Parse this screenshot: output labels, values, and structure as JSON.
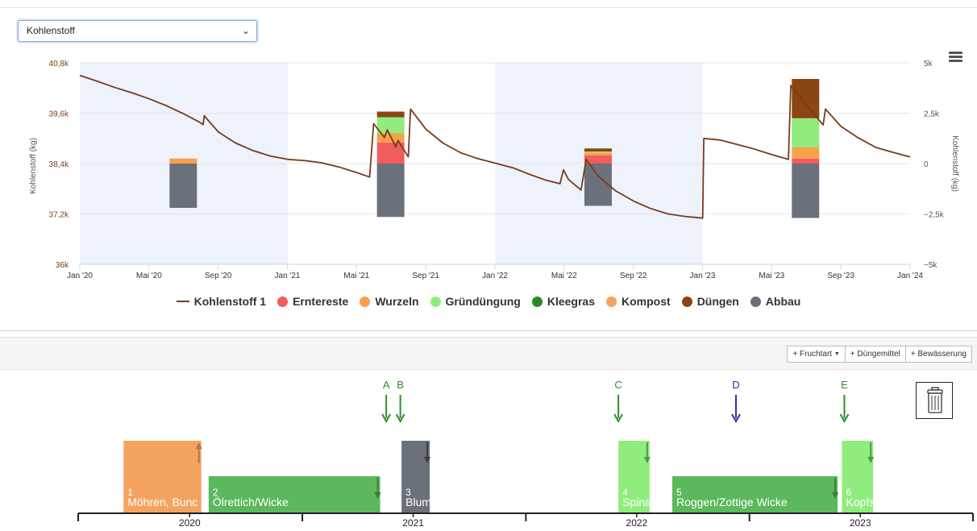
{
  "select": {
    "value": "Kohlenstoff"
  },
  "chart_data": {
    "type": "line+stacked-bar",
    "title": "",
    "yaxis_left": {
      "label": "Kohlenstoff (kg)",
      "range": [
        36000,
        40800
      ],
      "ticks": [
        "40,8k",
        "39,6k",
        "38,4k",
        "37,2k",
        "36k"
      ]
    },
    "yaxis_right": {
      "label": "Kohlenstoff (kg)",
      "range": [
        -5000,
        5000
      ],
      "ticks": [
        "5k",
        "2,5k",
        "0",
        "−2,5k",
        "−5k"
      ]
    },
    "xaxis": {
      "range": [
        "2020-01-01",
        "2024-01-01"
      ],
      "ticks": [
        "Jan '20",
        "Mai '20",
        "Sep '20",
        "Jan '21",
        "Mai '21",
        "Sep '21",
        "Jan '22",
        "Mai '22",
        "Sep '22",
        "Jan '23",
        "Mai '23",
        "Sep '23",
        "Jan '24"
      ]
    },
    "shaded_years": [
      "2020",
      "2022"
    ],
    "legend_position": "bottom",
    "line": {
      "name": "Kohlenstoff 1",
      "color": "#7a3b1a",
      "points": [
        [
          "2020-01-01",
          40500
        ],
        [
          "2020-02-01",
          40360
        ],
        [
          "2020-03-01",
          40220
        ],
        [
          "2020-04-01",
          40090
        ],
        [
          "2020-05-01",
          39950
        ],
        [
          "2020-06-01",
          39780
        ],
        [
          "2020-07-01",
          39590
        ],
        [
          "2020-07-28",
          39400
        ],
        [
          "2020-08-05",
          39330
        ],
        [
          "2020-08-07",
          39540
        ],
        [
          "2020-08-12",
          39460
        ],
        [
          "2020-09-01",
          39150
        ],
        [
          "2020-10-01",
          38890
        ],
        [
          "2020-11-01",
          38710
        ],
        [
          "2020-12-01",
          38580
        ],
        [
          "2021-01-01",
          38500
        ],
        [
          "2021-02-01",
          38470
        ],
        [
          "2021-03-01",
          38420
        ],
        [
          "2021-04-01",
          38320
        ],
        [
          "2021-05-01",
          38190
        ],
        [
          "2021-05-25",
          38080
        ],
        [
          "2021-06-01",
          39350
        ],
        [
          "2021-06-20",
          39020
        ],
        [
          "2021-06-25",
          39200
        ],
        [
          "2021-07-10",
          38800
        ],
        [
          "2021-07-14",
          38950
        ],
        [
          "2021-08-01",
          38560
        ],
        [
          "2021-08-05",
          39700
        ],
        [
          "2021-09-01",
          39220
        ],
        [
          "2021-10-01",
          38890
        ],
        [
          "2021-11-01",
          38660
        ],
        [
          "2021-12-01",
          38520
        ],
        [
          "2022-01-01",
          38410
        ],
        [
          "2022-02-01",
          38300
        ],
        [
          "2022-03-01",
          38150
        ],
        [
          "2022-04-01",
          38000
        ],
        [
          "2022-04-25",
          37920
        ],
        [
          "2022-05-01",
          38250
        ],
        [
          "2022-05-10",
          38020
        ],
        [
          "2022-06-01",
          37770
        ],
        [
          "2022-06-10",
          38500
        ],
        [
          "2022-07-01",
          38100
        ],
        [
          "2022-08-01",
          37750
        ],
        [
          "2022-09-01",
          37510
        ],
        [
          "2022-10-01",
          37330
        ],
        [
          "2022-11-01",
          37200
        ],
        [
          "2022-12-01",
          37140
        ],
        [
          "2023-01-01",
          37100
        ],
        [
          "2023-01-03",
          39000
        ],
        [
          "2023-02-01",
          38960
        ],
        [
          "2023-03-01",
          38860
        ],
        [
          "2023-04-01",
          38750
        ],
        [
          "2023-05-01",
          38620
        ],
        [
          "2023-06-01",
          38500
        ],
        [
          "2023-06-05",
          40260
        ],
        [
          "2023-07-01",
          39820
        ],
        [
          "2023-08-01",
          39320
        ],
        [
          "2023-08-05",
          39700
        ],
        [
          "2023-09-01",
          39290
        ],
        [
          "2023-10-01",
          39020
        ],
        [
          "2023-11-01",
          38790
        ],
        [
          "2023-12-01",
          38670
        ],
        [
          "2024-01-01",
          38560
        ]
      ]
    },
    "bar_series": [
      {
        "name": "Erntereste",
        "color": "#f15c5e"
      },
      {
        "name": "Wurzeln",
        "color": "#f7a14b"
      },
      {
        "name": "Gründüngung",
        "color": "#90ed7d"
      },
      {
        "name": "Kleegras",
        "color": "#2a8a2a"
      },
      {
        "name": "Kompost",
        "color": "#f4a460"
      },
      {
        "name": "Düngen",
        "color": "#8b4513"
      },
      {
        "name": "Abbau",
        "color": "#6b717b"
      }
    ],
    "bars": [
      {
        "x": "2020-07-01",
        "Erntereste": 0,
        "Wurzeln": 250,
        "Gründüngung": 0,
        "Kleegras": 0,
        "Kompost": 0,
        "Düngen": 0,
        "Abbau": -2200
      },
      {
        "x": "2021-07-01",
        "Erntereste": 1050,
        "Wurzeln": 450,
        "Gründüngung": 800,
        "Kleegras": 0,
        "Kompost": 0,
        "Düngen": 280,
        "Abbau": -2650
      },
      {
        "x": "2022-07-01",
        "Erntereste": 400,
        "Wurzeln": 150,
        "Gründüngung": 50,
        "Kleegras": 0,
        "Kompost": 0,
        "Düngen": 150,
        "Abbau": -2100
      },
      {
        "x": "2023-07-01",
        "Erntereste": 250,
        "Wurzeln": 550,
        "Gründüngung": 1450,
        "Kleegras": 0,
        "Kompost": 0,
        "Düngen": 1950,
        "Abbau": -2700
      }
    ]
  },
  "legend": [
    {
      "label": "Kohlenstoff 1",
      "kind": "line",
      "color": "#7a3b1a"
    },
    {
      "label": "Erntereste",
      "kind": "dot",
      "color": "#f15c5e"
    },
    {
      "label": "Wurzeln",
      "kind": "dot",
      "color": "#f7a14b"
    },
    {
      "label": "Gründüngung",
      "kind": "dot",
      "color": "#90ed7d"
    },
    {
      "label": "Kleegras",
      "kind": "dot",
      "color": "#2a8a2a"
    },
    {
      "label": "Kompost",
      "kind": "dot",
      "color": "#f4a460"
    },
    {
      "label": "Düngen",
      "kind": "dot",
      "color": "#8b4513"
    },
    {
      "label": "Abbau",
      "kind": "dot",
      "color": "#6b717b"
    }
  ],
  "toolbar": {
    "fruchtart": "+ Fruchtart",
    "duengemittel": "+ Düngemittel",
    "bewaesserung": "+ Bewässerung"
  },
  "timeline": {
    "range": [
      "2020-01-01",
      "2024-01-01"
    ],
    "years": [
      "2020",
      "2021",
      "2022",
      "2023"
    ],
    "markers": [
      {
        "label": "A",
        "date": "2021-05-18",
        "color": "#2e8b2e"
      },
      {
        "label": "B",
        "date": "2021-06-10",
        "color": "#2e8b2e"
      },
      {
        "label": "C",
        "date": "2022-06-01",
        "color": "#2e8b2e"
      },
      {
        "label": "D",
        "date": "2022-12-10",
        "color": "#3a2aa8"
      },
      {
        "label": "E",
        "date": "2023-06-05",
        "color": "#2e8b2e"
      }
    ],
    "crops": [
      {
        "num": "1",
        "name": "Möhren, Bunc",
        "start": "2020-03-15",
        "end": "2020-07-20",
        "row": "high",
        "color": "#f4a460",
        "arrow": "up",
        "arrow_color": "#b5773e"
      },
      {
        "num": "2",
        "name": "Ölrettich/Wicke",
        "start": "2020-08-01",
        "end": "2021-05-08",
        "row": "low",
        "color": "#5cb85c",
        "arrow": "down",
        "arrow_color": "#3d7a3d"
      },
      {
        "num": "3",
        "name": "Blum",
        "start": "2021-06-12",
        "end": "2021-07-28",
        "row": "high",
        "color": "#6b717b",
        "arrow": "down",
        "arrow_color": "#3a3e44"
      },
      {
        "num": "4",
        "name": "Spina",
        "start": "2022-06-01",
        "end": "2022-07-22",
        "row": "high",
        "color": "#90ed7d",
        "arrow": "down",
        "arrow_color": "#4a9a44"
      },
      {
        "num": "5",
        "name": "Roggen/Zottige Wicke",
        "start": "2022-08-28",
        "end": "2023-05-25",
        "row": "low",
        "color": "#5cb85c",
        "arrow": "down",
        "arrow_color": "#3d7a3d"
      },
      {
        "num": "6",
        "name": "Kopfs",
        "start": "2023-06-01",
        "end": "2023-07-22",
        "row": "high",
        "color": "#90ed7d",
        "arrow": "down",
        "arrow_color": "#4a9a44"
      }
    ]
  }
}
